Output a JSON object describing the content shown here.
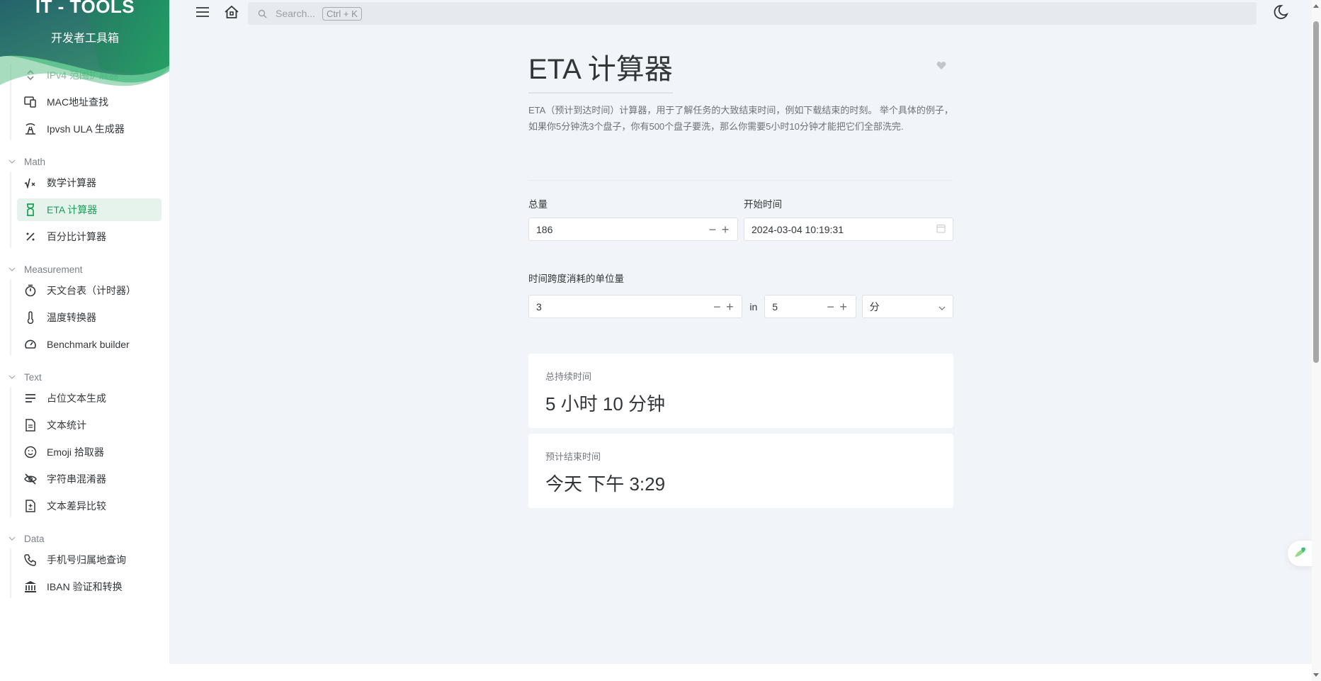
{
  "brand": {
    "title": "IT - TOOLS",
    "subtitle": "开发者工具箱"
  },
  "sidebar": {
    "partial_items": [
      {
        "label": "IPv4 范围扩展器",
        "icon": "unfold-icon"
      },
      {
        "label": "MAC地址查找",
        "icon": "devices-icon"
      },
      {
        "label": "Ipvsh ULA 生成器",
        "icon": "building-broadcast-icon"
      }
    ],
    "groups": [
      {
        "name": "Math",
        "items": [
          {
            "label": "数学计算器",
            "icon": "square-root-icon"
          },
          {
            "label": "ETA 计算器",
            "icon": "hourglass-icon",
            "active": true
          },
          {
            "label": "百分比计算器",
            "icon": "percentage-icon"
          }
        ]
      },
      {
        "name": "Measurement",
        "items": [
          {
            "label": "天文台表（计时器）",
            "icon": "stopwatch-icon"
          },
          {
            "label": "温度转换器",
            "icon": "thermometer-icon"
          },
          {
            "label": "Benchmark builder",
            "icon": "speedometer-icon"
          }
        ]
      },
      {
        "name": "Text",
        "items": [
          {
            "label": "占位文本生成",
            "icon": "align-justified-icon"
          },
          {
            "label": "文本统计",
            "icon": "file-text-icon"
          },
          {
            "label": "Emoji 拾取器",
            "icon": "mood-smile-icon"
          },
          {
            "label": "字符串混淆器",
            "icon": "eye-off-icon"
          },
          {
            "label": "文本差异比较",
            "icon": "file-diff-icon"
          }
        ]
      },
      {
        "name": "Data",
        "items": [
          {
            "label": "手机号归属地查询",
            "icon": "phone-icon"
          },
          {
            "label": "IBAN 验证和转换",
            "icon": "bank-icon"
          }
        ]
      }
    ]
  },
  "topbar": {
    "search_placeholder": "Search...",
    "search_shortcut": "Ctrl + K"
  },
  "page": {
    "title": "ETA 计算器",
    "description": "ETA（预计到达时间）计算器，用于了解任务的大致结束时间，例如下载结束的时刻。 举个具体的例子，如果你5分钟洗3个盘子，你有500个盘子要洗，那么你需要5小时10分钟才能把它们全部洗完."
  },
  "form": {
    "total_label": "总量",
    "total_value": "186",
    "start_label": "开始时间",
    "start_value": "2024-03-04 10:19:31",
    "unit_label": "时间跨度消耗的单位量",
    "units_value": "3",
    "in_label": "in",
    "span_value": "5",
    "span_unit": "分"
  },
  "results": {
    "duration_label": "总持续时间",
    "duration_value": "5 小时 10 分钟",
    "end_label": "预计结束时间",
    "end_value": "今天 下午 3:29"
  },
  "colors": {
    "accent": "#18a058",
    "background": "#f1f4f9"
  }
}
